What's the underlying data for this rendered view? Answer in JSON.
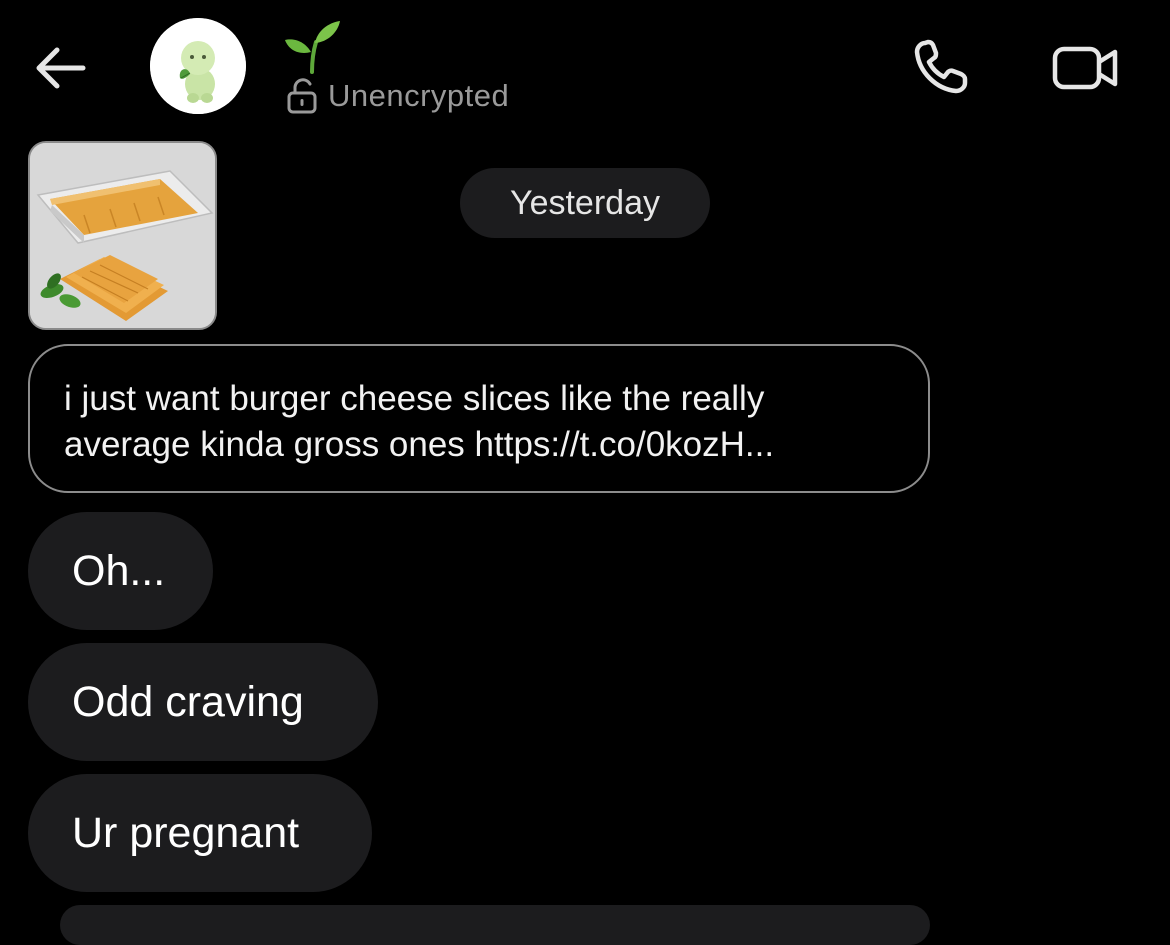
{
  "header": {
    "back_icon": "arrow-left-icon",
    "avatar_icon": "green-figurine-avatar",
    "name_emoji": "🌱",
    "encryption_icon": "unlocked-padlock-icon",
    "encryption_label": "Unencrypted",
    "call_icon": "phone-icon",
    "video_icon": "video-camera-icon"
  },
  "thread": {
    "shared_image_icon": "cheese-slices-photo",
    "date_label": "Yesterday",
    "shared_message": "i just want burger cheese slices like the really average kinda gross ones https://t.co/0kozH...",
    "messages": [
      "Oh...",
      "Odd craving",
      "Ur pregnant"
    ]
  },
  "colors": {
    "background": "#000000",
    "bubble": "#1c1c1e",
    "secondary_text": "#9a9a9a",
    "outline": "#8c8c8c"
  }
}
